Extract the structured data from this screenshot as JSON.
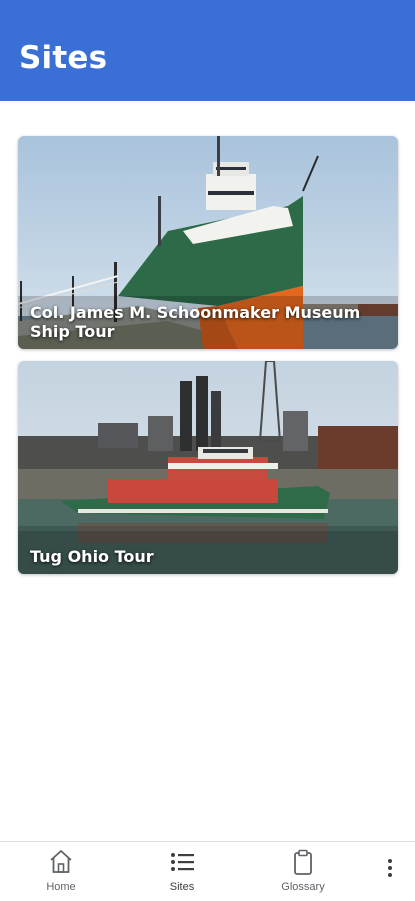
{
  "header": {
    "title": "Sites"
  },
  "sites": [
    {
      "title": "Col. James M. Schoonmaker Museum Ship Tour"
    },
    {
      "title": "Tug Ohio Tour"
    }
  ],
  "bottom_nav": {
    "items": [
      {
        "label": "Home",
        "icon": "home-icon"
      },
      {
        "label": "Sites",
        "icon": "list-icon"
      },
      {
        "label": "Glossary",
        "icon": "clipboard-icon"
      }
    ],
    "more_icon": "more-vert-icon"
  },
  "colors": {
    "app_bar": "#3a6fd6",
    "nav_text": "#5f6368"
  }
}
